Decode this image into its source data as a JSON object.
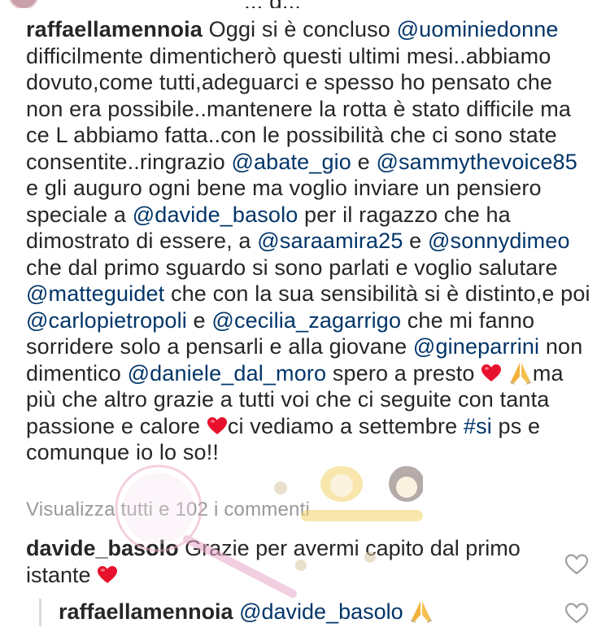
{
  "top_fragment": "... g...",
  "caption": {
    "username": "raffaellamennoia",
    "segments": [
      {
        "type": "text",
        "v": " Oggi si è concluso "
      },
      {
        "type": "tag",
        "v": "@uominiedonne"
      },
      {
        "type": "text",
        "v": " difficilmente dimenticherò questi ultimi mesi..abbiamo dovuto,come tutti,adeguarci e spesso ho pensato che non era possibile..mantenere la rotta è stato difficile ma ce L abbiamo fatta..con le possibilità che ci sono state consentite..ringrazio "
      },
      {
        "type": "tag",
        "v": "@abate_gio"
      },
      {
        "type": "text",
        "v": "  e "
      },
      {
        "type": "tag",
        "v": "@sammythevoice85"
      },
      {
        "type": "text",
        "v": "  e gli auguro ogni bene ma voglio inviare un pensiero speciale a "
      },
      {
        "type": "tag",
        "v": "@davide_basolo"
      },
      {
        "type": "text",
        "v": "  per il ragazzo che ha dimostrato di essere, a "
      },
      {
        "type": "tag",
        "v": "@saraamira25"
      },
      {
        "type": "text",
        "v": "  e "
      },
      {
        "type": "tag",
        "v": "@sonnydimeo"
      },
      {
        "type": "text",
        "v": " che dal primo sguardo si sono parlati e voglio salutare "
      },
      {
        "type": "tag",
        "v": "@matteguidet"
      },
      {
        "type": "text",
        "v": "  che  con la sua sensibilità si è distinto,e poi "
      },
      {
        "type": "tag",
        "v": "@carlopietropoli"
      },
      {
        "type": "text",
        "v": " e "
      },
      {
        "type": "tag",
        "v": "@cecilia_zagarrigo"
      },
      {
        "type": "text",
        "v": " che mi fanno sorridere solo a pensarli e alla giovane "
      },
      {
        "type": "tag",
        "v": "@gineparrini"
      },
      {
        "type": "text",
        "v": "  non dimentico "
      },
      {
        "type": "tag",
        "v": "@daniele_dal_moro"
      },
      {
        "type": "text",
        "v": " spero a presto "
      },
      {
        "type": "emoji",
        "v": "heart-emoji"
      },
      {
        "type": "text",
        "v": " "
      },
      {
        "type": "emoji",
        "v": "pray-emoji"
      },
      {
        "type": "text",
        "v": "ma più che altro grazie a tutti voi che ci seguite con tanta passione e calore "
      },
      {
        "type": "emoji",
        "v": "heart-emoji"
      },
      {
        "type": "text",
        "v": "ci vediamo a settembre "
      },
      {
        "type": "tag",
        "v": "#si"
      },
      {
        "type": "text",
        "v": " ps e comunque io lo so!!"
      }
    ]
  },
  "view_all_comments": "Visualizza tutti e 102 i commenti",
  "comment": {
    "username": "davide_basolo",
    "text": " Grazie per avermi capito dal primo istante ",
    "emoji": "heart-emoji"
  },
  "reply": {
    "username": "raffaellamennoia",
    "mention": "@davide_basolo",
    "emoji": "pray-emoji"
  },
  "colors": {
    "text": "#262626",
    "mention": "#003569",
    "muted": "#999999",
    "heart": "#e8112d"
  },
  "icons": {
    "like": "heart-outline-icon"
  }
}
